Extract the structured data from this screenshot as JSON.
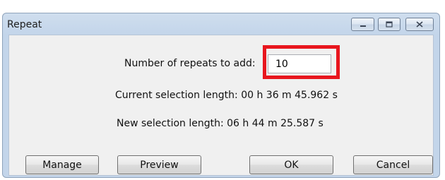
{
  "window": {
    "title": "Repeat",
    "controls": {
      "minimize_icon": "minimize-icon",
      "maximize_icon": "maximize-icon",
      "close_icon": "close-icon"
    }
  },
  "form": {
    "repeats_label": "Number of repeats to add:",
    "repeats_value": "10",
    "current_selection": "Current selection length: 00 h 36 m 45.962 s",
    "new_selection": "New selection length: 06 h 44 m 25.587 s"
  },
  "buttons": {
    "manage": "Manage",
    "preview": "Preview",
    "ok": "OK",
    "cancel": "Cancel"
  },
  "annotation": {
    "highlight_color": "#e8161e"
  }
}
